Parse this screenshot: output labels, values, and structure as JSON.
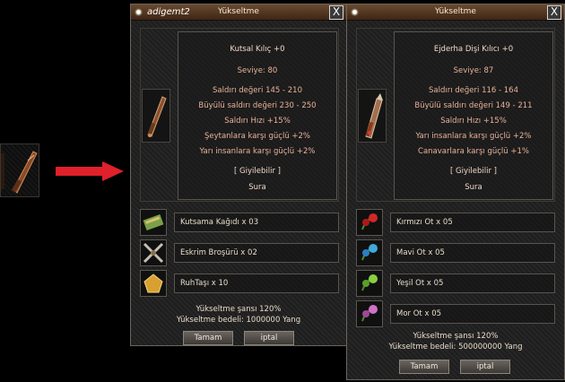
{
  "source_item": {
    "icon": "sword-icon"
  },
  "arrow": {
    "color": "#e0202a"
  },
  "window1": {
    "owner": "adigemt2",
    "title": "Yükseltme",
    "close": "X",
    "item_icon": "holy-sword-icon",
    "stats": [
      "Kutsal Kılıç +0",
      "Seviye: 80",
      "Saldırı değeri 145 - 210",
      "Büyülü saldırı değeri 230 - 250",
      "Saldırı Hızı +15%",
      "Şeytanlara karşı güçlü +2%",
      "Yarı insanlara karşı güçlü +2%",
      "[ Giyilebilir ]",
      "Sura"
    ],
    "materials": [
      {
        "label": "Kutsama Kağıdı x 03",
        "icon": "blessing-scroll-icon"
      },
      {
        "label": "Eskrim Broşürü x 02",
        "icon": "fencing-brochure-icon"
      },
      {
        "label": "RuhTaşı x 10",
        "icon": "spirit-stone-icon"
      }
    ],
    "chance": "Yükseltme şansı 120%",
    "cost": "Yükseltme bedeli: 1000000 Yang",
    "ok": "Tamam",
    "cancel": "iptal"
  },
  "window2": {
    "title": "Yükseltme",
    "close": "X",
    "item_icon": "dragon-tooth-sword-icon",
    "stats": [
      "Ejderha Dişi Kılıcı +0",
      "Seviye: 87",
      "Saldırı değeri 116 - 164",
      "Büyülü saldırı değeri 149 - 211",
      "Saldırı Hızı +15%",
      "Yarı insanlara karşı güçlü +2%",
      "Canavarlara karşı güçlü +1%",
      "[ Giyilebilir ]",
      "Sura"
    ],
    "materials": [
      {
        "label": "Kırmızı Ot x 05",
        "icon": "red-herb-icon"
      },
      {
        "label": "Mavi Ot x 05",
        "icon": "blue-herb-icon"
      },
      {
        "label": "Yeşil Ot x 05",
        "icon": "green-herb-icon"
      },
      {
        "label": "Mor Ot x 05",
        "icon": "purple-herb-icon"
      }
    ],
    "chance": "Yükseltme şansı 120%",
    "cost": "Yükseltme bedeli: 500000000 Yang",
    "ok": "Tamam",
    "cancel": "iptal"
  }
}
